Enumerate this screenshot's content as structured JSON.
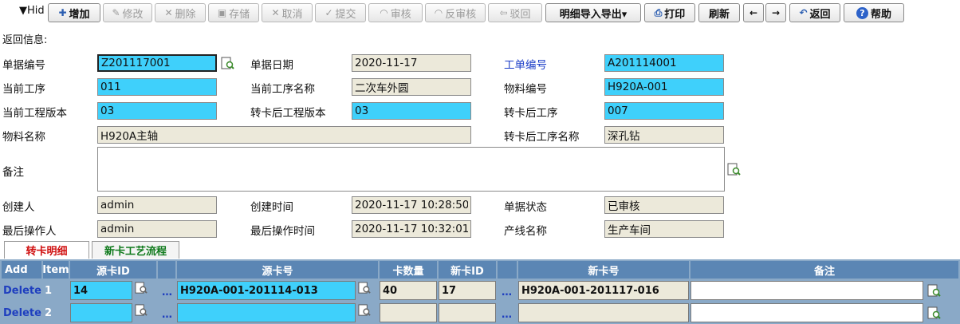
{
  "toolbar": {
    "hide_label": "▼Hid",
    "buttons": [
      {
        "label": "增加",
        "icon": "✚",
        "enabled": true
      },
      {
        "label": "修改",
        "icon": "✎",
        "enabled": false
      },
      {
        "label": "删除",
        "icon": "✕",
        "enabled": false
      },
      {
        "label": "存储",
        "icon": "▣",
        "enabled": false
      },
      {
        "label": "取消",
        "icon": "✕",
        "enabled": false
      },
      {
        "label": "提交",
        "icon": "✓",
        "enabled": false
      },
      {
        "label": "审核",
        "icon": "◠",
        "enabled": false
      },
      {
        "label": "反审核",
        "icon": "◠",
        "enabled": false
      },
      {
        "label": "驳回",
        "icon": "⇦",
        "enabled": false
      },
      {
        "label": "明细导入导出▾",
        "icon": "",
        "enabled": true
      },
      {
        "label": "打印",
        "icon": "⎙",
        "enabled": true
      },
      {
        "label": "刷新",
        "icon": "",
        "enabled": true
      },
      {
        "label": "",
        "icon": "←",
        "enabled": true
      },
      {
        "label": "",
        "icon": "→",
        "enabled": true
      },
      {
        "label": "返回",
        "icon": "↶",
        "enabled": true
      },
      {
        "label": "帮助",
        "icon": "?",
        "enabled": true
      }
    ]
  },
  "return_info": "返回信息:",
  "form": {
    "doc_no_label": "单据编号",
    "doc_no": "Z201117001",
    "doc_date_label": "单据日期",
    "doc_date": "2020-11-17",
    "work_order_label": "工单编号",
    "work_order": "A201114001",
    "cur_process_label": "当前工序",
    "cur_process": "011",
    "cur_process_name_label": "当前工序名称",
    "cur_process_name": "二次车外圆",
    "material_no_label": "物料编号",
    "material_no": "H920A-001",
    "cur_version_label": "当前工程版本",
    "cur_version": "03",
    "after_version_label": "转卡后工程版本",
    "after_version": "03",
    "after_process_label": "转卡后工序",
    "after_process": "007",
    "material_name_label": "物料名称",
    "material_name": "H920A主轴",
    "after_process_name_label": "转卡后工序名称",
    "after_process_name": "深孔钻",
    "remark_label": "备注",
    "remark": "",
    "creator_label": "创建人",
    "creator": "admin",
    "created_label": "创建时间",
    "created": "2020-11-17 10:28:50",
    "status_label": "单据状态",
    "status": "已审核",
    "last_op_label": "最后操作人",
    "last_op": "admin",
    "last_time_label": "最后操作时间",
    "last_time": "2020-11-17 10:32:01",
    "line_label": "产线名称",
    "line": "生产车间"
  },
  "tabs": [
    "转卡明细",
    "新卡工艺流程"
  ],
  "grid": {
    "add": "Add",
    "headers": [
      "Item",
      "源卡ID",
      "源卡号",
      "卡数量",
      "新卡ID",
      "新卡号",
      "备注"
    ],
    "rows": [
      {
        "action": "Delete",
        "item": "1",
        "src_id": "14",
        "src_no": "H920A-001-201114-013",
        "qty": "40",
        "new_id": "17",
        "new_no": "H920A-001-201117-016",
        "remark": ""
      },
      {
        "action": "Delete",
        "item": "2",
        "src_id": "",
        "src_no": "",
        "qty": "",
        "new_id": "",
        "new_no": "",
        "remark": ""
      }
    ]
  },
  "colors": {
    "cyan": "#3fd0fb",
    "beige": "#ece9da",
    "header_blue": "#5b86b4"
  }
}
